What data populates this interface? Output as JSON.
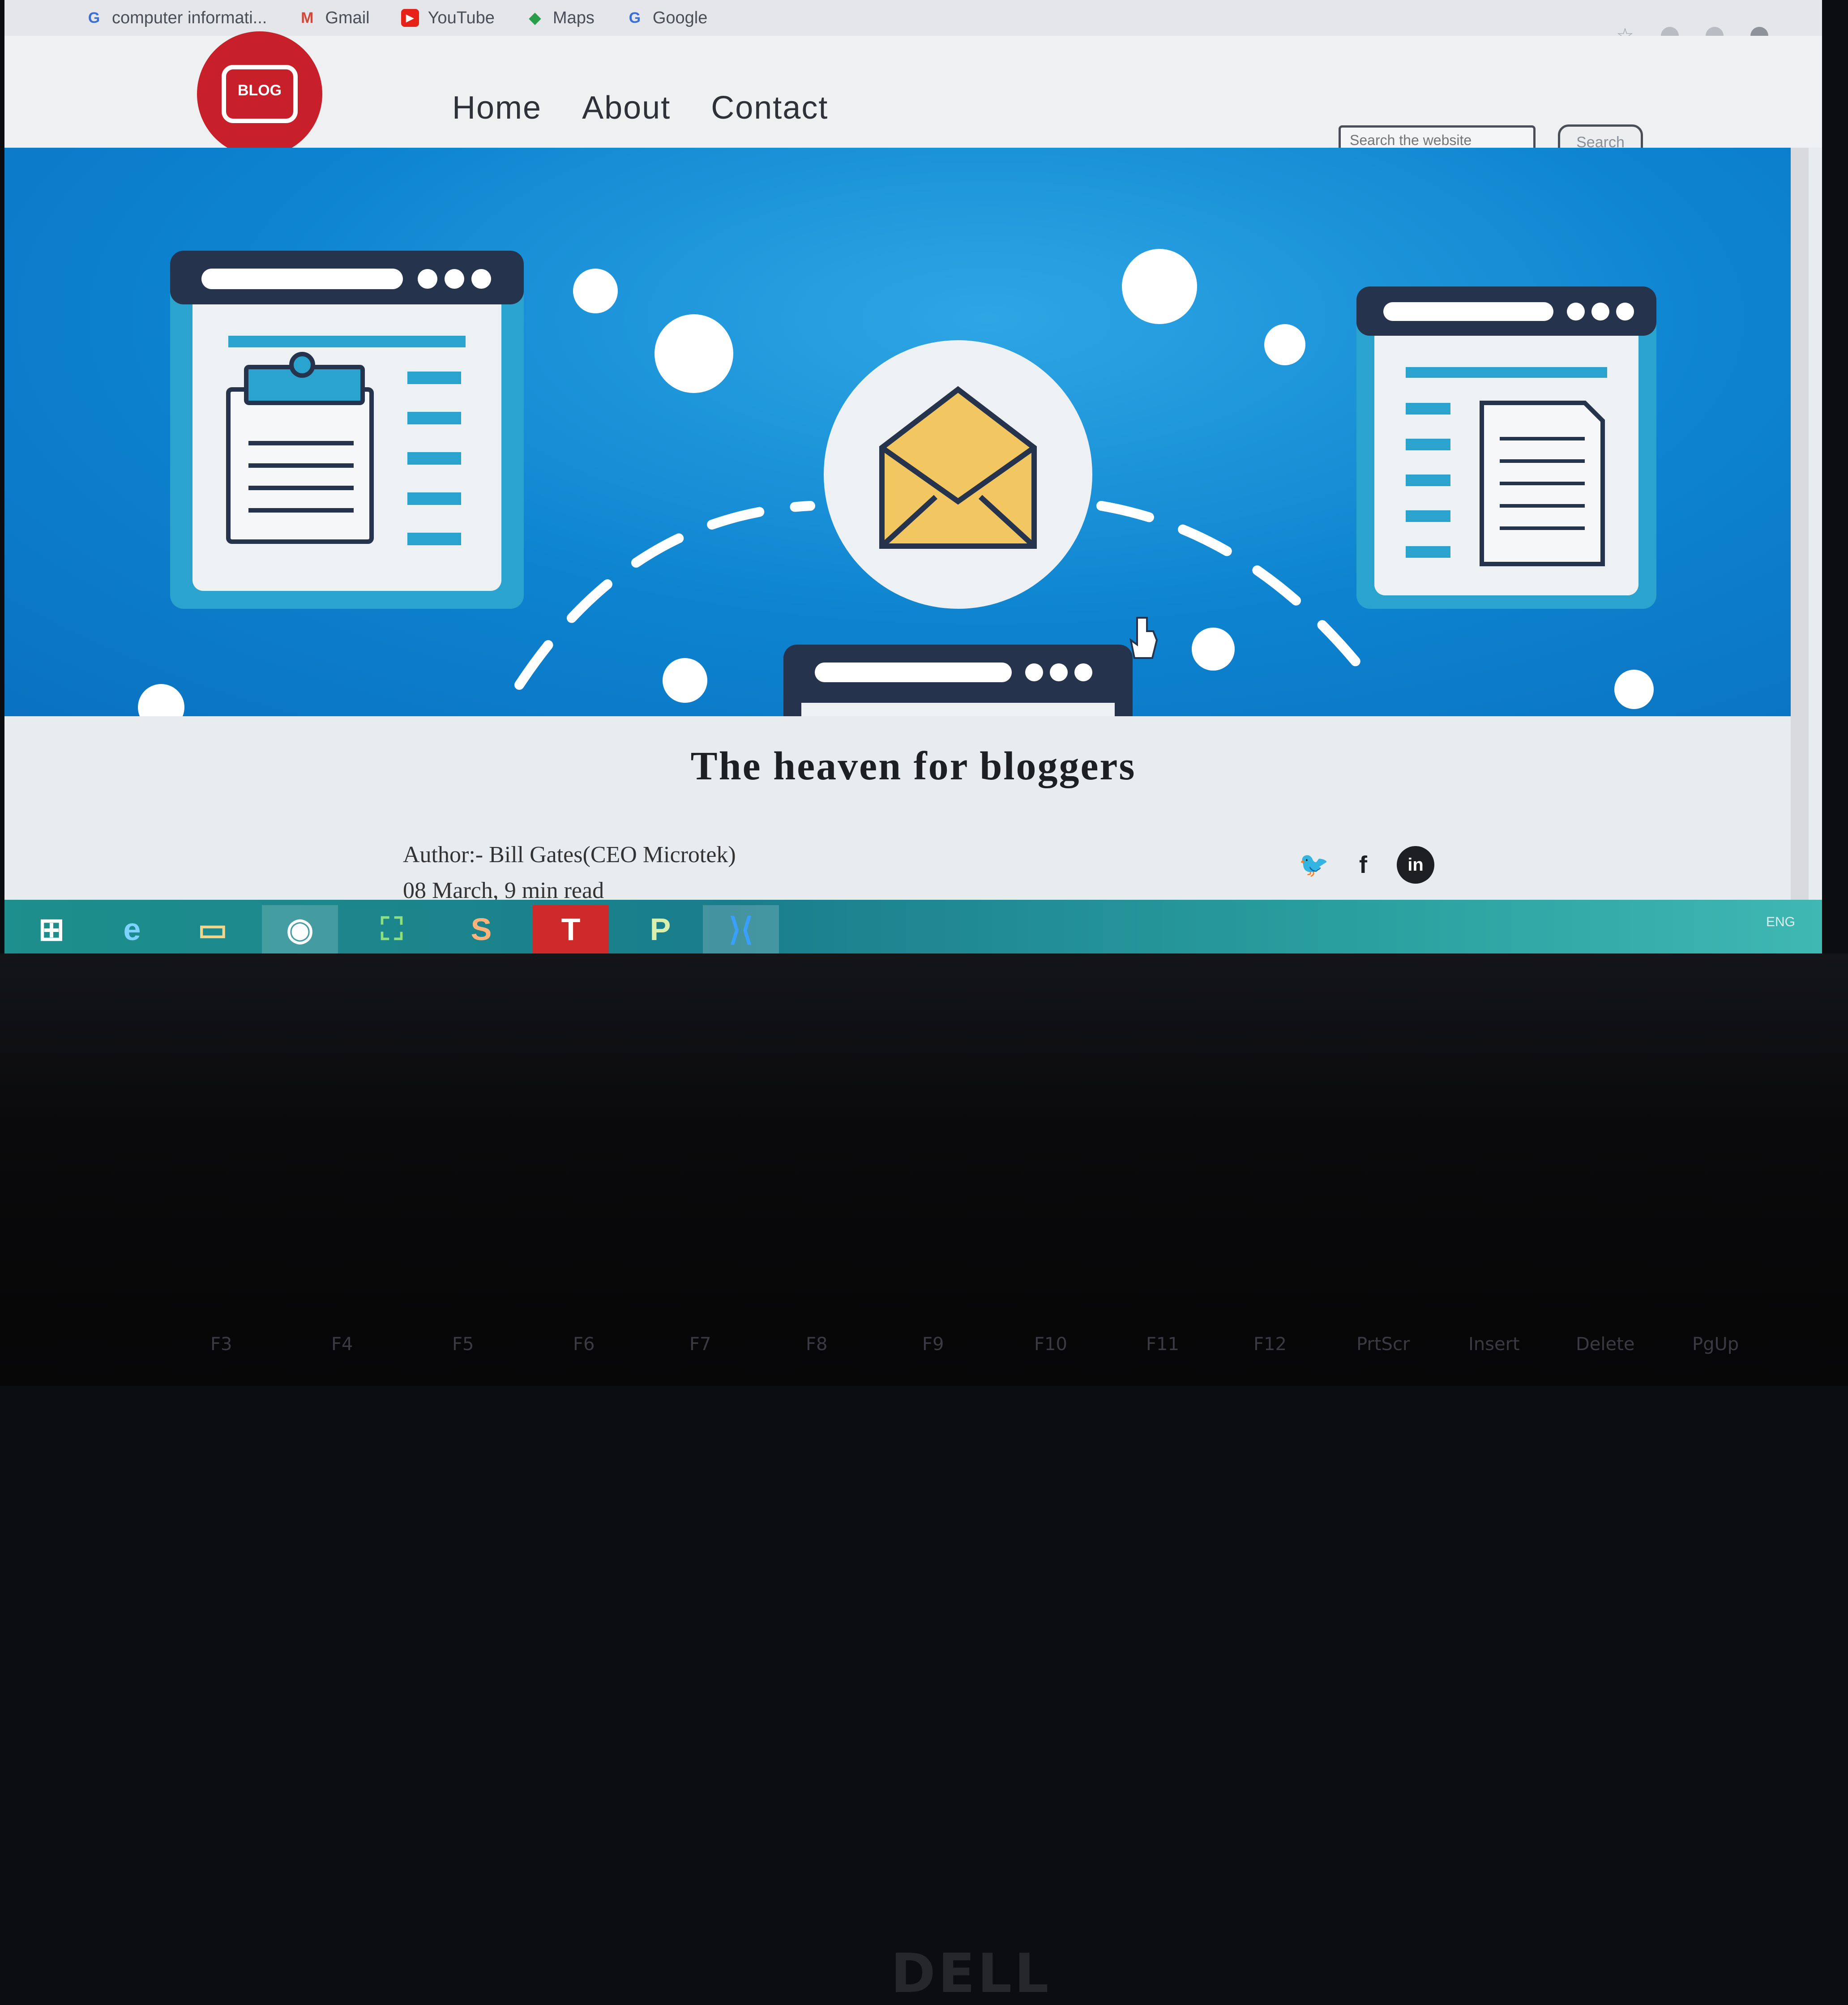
{
  "bookmarks": [
    {
      "label": "computer informati...",
      "icon": "google-icon"
    },
    {
      "label": "Gmail",
      "icon": "gmail-icon"
    },
    {
      "label": "YouTube",
      "icon": "youtube-icon"
    },
    {
      "label": "Maps",
      "icon": "maps-icon"
    },
    {
      "label": "Google",
      "icon": "google-icon"
    }
  ],
  "logo": {
    "text": "BLOG"
  },
  "nav": {
    "home": "Home",
    "about": "About",
    "contact": "Contact"
  },
  "search": {
    "placeholder": "Search the website",
    "button": "Search"
  },
  "article": {
    "title": "The heaven for bloggers",
    "author": "Author:- Bill Gates(CEO Microtek)",
    "meta": "08 March, 9 min read"
  },
  "social": [
    "twitter-icon",
    "facebook-icon",
    "linkedin-icon"
  ],
  "taskbar": {
    "apps": [
      "windows-start-icon",
      "internet-explorer-icon",
      "file-explorer-icon",
      "chrome-icon",
      "store-icon",
      "s-app-icon",
      "t-app-icon",
      "p-app-icon",
      "vscode-icon"
    ]
  },
  "tray": {
    "lang": "ENG"
  },
  "laptop": {
    "brand": "DELL",
    "fkeys": [
      "F3",
      "F4",
      "F5",
      "F6",
      "F7",
      "F8",
      "F9",
      "F10",
      "F11",
      "F12",
      "PrtScr",
      "Insert",
      "Delete",
      "PgUp"
    ]
  },
  "colors": {
    "brand_red": "#c8202b",
    "hero_blue": "#0d83cf",
    "envelope": "#f2c661",
    "taskbar": "#1d8f8c"
  }
}
